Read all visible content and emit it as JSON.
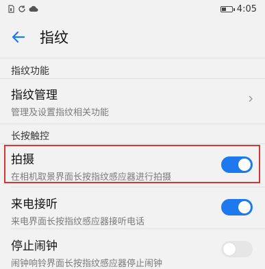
{
  "status_bar": {
    "time": "4:05",
    "icons": [
      "sim-icon",
      "sync-icon",
      "cloud-icon",
      "battery-icon"
    ]
  },
  "header": {
    "title": "指纹",
    "back_icon": "back-arrow-icon"
  },
  "sections": [
    {
      "title": "指纹功能",
      "items": [
        {
          "title": "指纹管理",
          "subtitle": "管理及设置指纹相关功能",
          "control": "chevron"
        }
      ]
    },
    {
      "title": "长按触控",
      "items": [
        {
          "title": "拍摄",
          "subtitle": "在相机取景界面长按指纹感应器进行拍摄",
          "control": "toggle",
          "enabled": true,
          "highlighted": true
        },
        {
          "title": "来电接听",
          "subtitle": "来电界面长按指纹感应器接听电话",
          "control": "toggle",
          "enabled": true
        },
        {
          "title": "停止闹钟",
          "subtitle": "闹钟响铃界面长按指纹感应器停止闹钟",
          "control": "toggle",
          "enabled": false
        }
      ]
    }
  ],
  "colors": {
    "accent": "#1e79ee",
    "background": "#f2f2f2",
    "highlight": "#d83535"
  }
}
